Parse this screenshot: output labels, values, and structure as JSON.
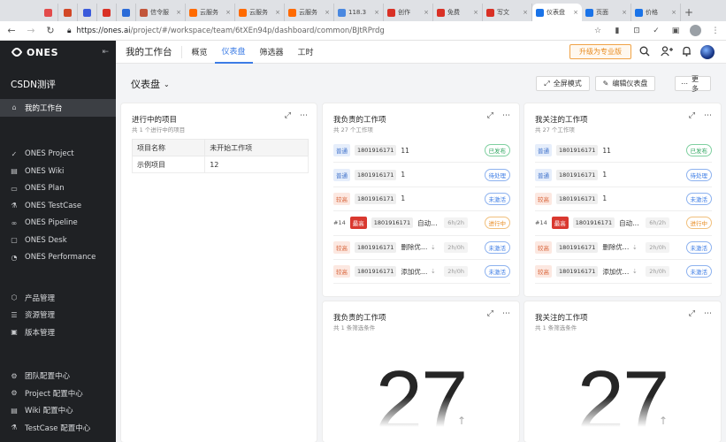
{
  "browser": {
    "tabs": [
      {
        "label": "",
        "color": "#e34b4b",
        "small": true
      },
      {
        "label": "",
        "color": "#d24726",
        "small": true
      },
      {
        "label": "",
        "color": "#3b5bdb",
        "small": true
      },
      {
        "label": "",
        "color": "#d93025",
        "small": true
      },
      {
        "label": "",
        "color": "#2b6bd8",
        "small": true
      },
      {
        "label": "信令服",
        "color": "#c2553a",
        "small": false
      },
      {
        "label": "云服务",
        "color": "#ff6a00",
        "small": false
      },
      {
        "label": "云服务",
        "color": "#ff6a00",
        "small": false
      },
      {
        "label": "云服务",
        "color": "#ff6a00",
        "small": false
      },
      {
        "label": "118.3",
        "color": "#4a88e0",
        "small": false
      },
      {
        "label": "创作",
        "color": "#d93025",
        "small": false
      },
      {
        "label": "免费",
        "color": "#d93025",
        "small": false
      },
      {
        "label": "写文",
        "color": "#d93025",
        "small": false
      },
      {
        "label": "仪表盘",
        "color": "#1a73e8",
        "small": false,
        "active": true
      },
      {
        "label": "页面",
        "color": "#1a73e8",
        "small": false
      },
      {
        "label": "价格",
        "color": "#1a73e8",
        "small": false
      }
    ],
    "url_host": "https://ones.ai",
    "url_path": "/project/#/workspace/team/6tXEn94p/dashboard/common/BJtRPrdg"
  },
  "sidebar": {
    "brand": "ONES",
    "org": "CSDN测评",
    "group1": [
      {
        "label": "我的工作台",
        "icon": "home-icon",
        "glyph": "⌂",
        "active": true
      }
    ],
    "group2": [
      {
        "label": "ONES Project",
        "icon": "project-icon",
        "glyph": "✓"
      },
      {
        "label": "ONES Wiki",
        "icon": "wiki-icon",
        "glyph": "▤"
      },
      {
        "label": "ONES Plan",
        "icon": "plan-icon",
        "glyph": "▭"
      },
      {
        "label": "ONES TestCase",
        "icon": "testcase-icon",
        "glyph": "⚗"
      },
      {
        "label": "ONES Pipeline",
        "icon": "pipeline-icon",
        "glyph": "∞"
      },
      {
        "label": "ONES Desk",
        "icon": "desk-icon",
        "glyph": "▢"
      },
      {
        "label": "ONES Performance",
        "icon": "performance-icon",
        "glyph": "◔"
      }
    ],
    "group3": [
      {
        "label": "产品管理",
        "icon": "product-icon",
        "glyph": "⬡"
      },
      {
        "label": "资源管理",
        "icon": "resource-icon",
        "glyph": "☰"
      },
      {
        "label": "版本管理",
        "icon": "version-icon",
        "glyph": "▣"
      }
    ],
    "group4": [
      {
        "label": "团队配置中心",
        "icon": "team-config-icon",
        "glyph": "⚙"
      },
      {
        "label": "Project 配置中心",
        "icon": "project-config-icon",
        "glyph": "⚙"
      },
      {
        "label": "Wiki 配置中心",
        "icon": "wiki-config-icon",
        "glyph": "▤"
      },
      {
        "label": "TestCase 配置中心",
        "icon": "testcase-config-icon",
        "glyph": "⚗"
      }
    ]
  },
  "header": {
    "workspace_title": "我的工作台",
    "tabs": [
      {
        "label": "概览",
        "active": false
      },
      {
        "label": "仪表盘",
        "active": true
      },
      {
        "label": "筛选器",
        "active": false
      },
      {
        "label": "工时",
        "active": false
      }
    ],
    "upgrade_label": "升级为专业版"
  },
  "dashboard": {
    "title": "仪表盘",
    "fullscreen_label": "全屏模式",
    "edit_label": "编辑仪表盘",
    "more_label": "更多"
  },
  "cards": {
    "projects": {
      "title": "进行中的项目",
      "subtitle": "共 1 个进行中的项目",
      "columns": [
        "项目名称",
        "未开始工作项"
      ],
      "rows": [
        [
          "示例项目",
          "12"
        ]
      ]
    },
    "my_tasks": {
      "title": "我负责的工作项",
      "subtitle": "共 27 个工作项"
    },
    "watched_tasks": {
      "title": "我关注的工作项",
      "subtitle": "共 27 个工作项"
    },
    "my_count": {
      "title": "我负责的工作项",
      "subtitle": "共 1 条筛选条件",
      "value": "27"
    },
    "watched_count": {
      "title": "我关注的工作项",
      "subtitle": "共 1 条筛选条件",
      "value": "27"
    }
  },
  "tasks": [
    {
      "num": "",
      "priority": "普通",
      "pri_class": "normal",
      "id": "1801916171",
      "name": "11",
      "time": "",
      "status": "已发布",
      "status_class": "done"
    },
    {
      "num": "",
      "priority": "普通",
      "pri_class": "normal",
      "id": "1801916171",
      "name": "1",
      "time": "",
      "status": "待处理",
      "status_class": "todo"
    },
    {
      "num": "",
      "priority": "较高",
      "pri_class": "high",
      "id": "1801916171",
      "name": "1",
      "time": "",
      "status": "未激活",
      "status_class": "todo"
    },
    {
      "num": "#14",
      "priority": "最高",
      "pri_class": "top",
      "id": "1801916171",
      "name": "自动…",
      "time": "6h/2h",
      "status": "进行中",
      "status_class": "inprog"
    },
    {
      "num": "",
      "priority": "较高",
      "pri_class": "high",
      "id": "1801916171",
      "name": "删除优…",
      "time": "2h/0h",
      "status": "未激活",
      "status_class": "todo",
      "sub": true
    },
    {
      "num": "",
      "priority": "较高",
      "pri_class": "high",
      "id": "1801916171",
      "name": "添加优…",
      "time": "2h/0h",
      "status": "未激活",
      "status_class": "todo",
      "sub": true
    }
  ]
}
